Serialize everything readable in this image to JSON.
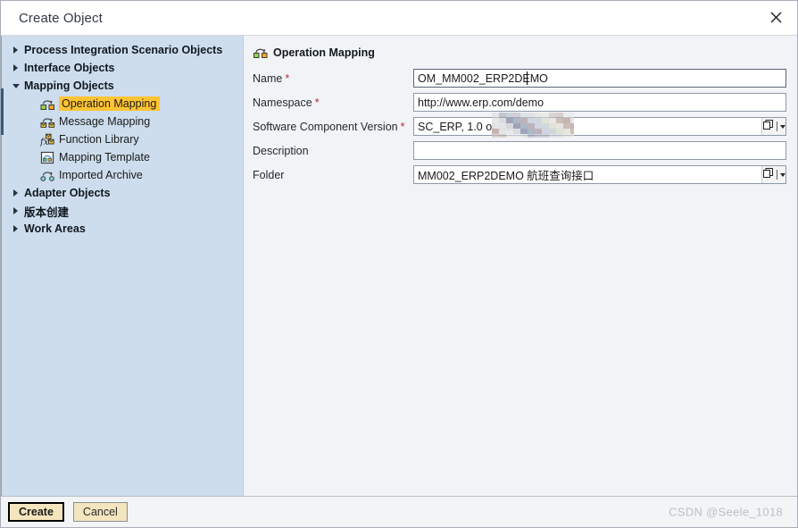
{
  "window": {
    "title": "Create Object",
    "close_icon": "close-icon"
  },
  "sidebar": {
    "items": [
      {
        "label": "Process Integration Scenario Objects",
        "level": 1,
        "state": "collapsed",
        "selected": false,
        "icon": ""
      },
      {
        "label": "Interface Objects",
        "level": 1,
        "state": "collapsed",
        "selected": false,
        "icon": ""
      },
      {
        "label": "Mapping Objects",
        "level": 1,
        "state": "expanded",
        "selected": false,
        "icon": ""
      },
      {
        "label": "Operation Mapping",
        "level": 2,
        "state": "leaf",
        "selected": true,
        "icon": "operation-mapping-icon"
      },
      {
        "label": "Message Mapping",
        "level": 2,
        "state": "leaf",
        "selected": false,
        "icon": "message-mapping-icon"
      },
      {
        "label": "Function Library",
        "level": 2,
        "state": "leaf",
        "selected": false,
        "icon": "function-library-icon"
      },
      {
        "label": "Mapping Template",
        "level": 2,
        "state": "leaf",
        "selected": false,
        "icon": "mapping-template-icon"
      },
      {
        "label": "Imported Archive",
        "level": 2,
        "state": "leaf",
        "selected": false,
        "icon": "imported-archive-icon"
      },
      {
        "label": "Adapter Objects",
        "level": 1,
        "state": "collapsed",
        "selected": false,
        "icon": ""
      },
      {
        "label": "版本创建",
        "level": 1,
        "state": "collapsed",
        "selected": false,
        "icon": ""
      },
      {
        "label": "Work Areas",
        "level": 1,
        "state": "collapsed",
        "selected": false,
        "icon": ""
      }
    ]
  },
  "main": {
    "header": {
      "title": "Operation Mapping",
      "icon": "operation-mapping-icon"
    },
    "fields": [
      {
        "label": "Name",
        "required": true,
        "value": "OM_MM002_ERP2DEMO",
        "placeholder": "",
        "focused": true,
        "has_value_help": false,
        "blurred": false
      },
      {
        "label": "Namespace",
        "required": true,
        "value": "http://www.erp.com/demo",
        "placeholder": "",
        "focused": false,
        "has_value_help": false,
        "blurred": false
      },
      {
        "label": "Software Component Version",
        "required": true,
        "value": "SC_ERP, 1.0 of ww",
        "placeholder": "",
        "focused": false,
        "has_value_help": true,
        "blurred": true
      },
      {
        "label": "Description",
        "required": false,
        "value": "",
        "placeholder": "",
        "focused": false,
        "has_value_help": false,
        "blurred": false
      },
      {
        "label": "Folder",
        "required": false,
        "value": "MM002_ERP2DEMO 航班查询接口",
        "placeholder": "",
        "focused": false,
        "has_value_help": true,
        "blurred": false
      }
    ],
    "required_marker": "*"
  },
  "footer": {
    "create_label": "Create",
    "cancel_label": "Cancel",
    "watermark": "CSDN @Seele_1018"
  },
  "colors": {
    "sidebar_bg": "#cddded",
    "main_bg": "#f2f3f7",
    "selection": "#ffc433",
    "required": "#b02a37",
    "marker": "#365a7d"
  }
}
